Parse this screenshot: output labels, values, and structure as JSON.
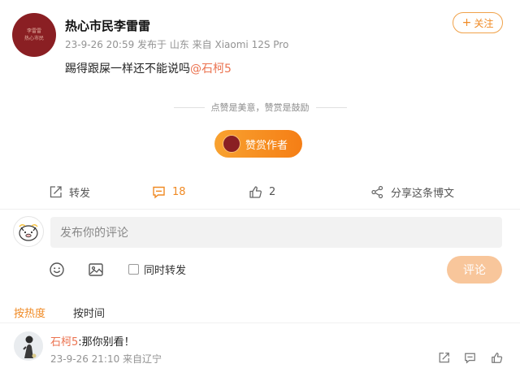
{
  "post": {
    "author": "热心市民李雷雷",
    "avatar_seal": "李雷雷 热心市民",
    "meta": "23-9-26 20:59  发布于 山东  来自 Xiaomi 12S Pro",
    "text_plain": "踢得跟屎一样还不能说吗",
    "mention": "@石柯5",
    "follow_label": "关注",
    "follow_plus": "+"
  },
  "reward": {
    "tip": "点赞是美意，赞赏是鼓励",
    "button_label": "赞赏作者"
  },
  "actions": {
    "forward_label": "转发",
    "comment_count": "18",
    "like_count": "2",
    "share_label": "分享这条博文"
  },
  "composer": {
    "placeholder": "发布你的评论",
    "repost_label": "同时转发",
    "submit_label": "评论"
  },
  "sort": {
    "hot_label": "按热度",
    "time_label": "按时间"
  },
  "comments": [
    {
      "user": "石柯5",
      "text": ":那你别看！",
      "meta": "23-9-26 21:10 来自辽宁"
    }
  ],
  "colors": {
    "accent": "#f08a24",
    "mention": "#eb7350",
    "meta": "#939393",
    "seal_red": "#8a1f23"
  },
  "icons": [
    "forward-icon",
    "comment-icon",
    "like-icon",
    "share-icon",
    "emoji-icon",
    "image-icon",
    "repost-icon",
    "reply-icon",
    "like-icon"
  ]
}
